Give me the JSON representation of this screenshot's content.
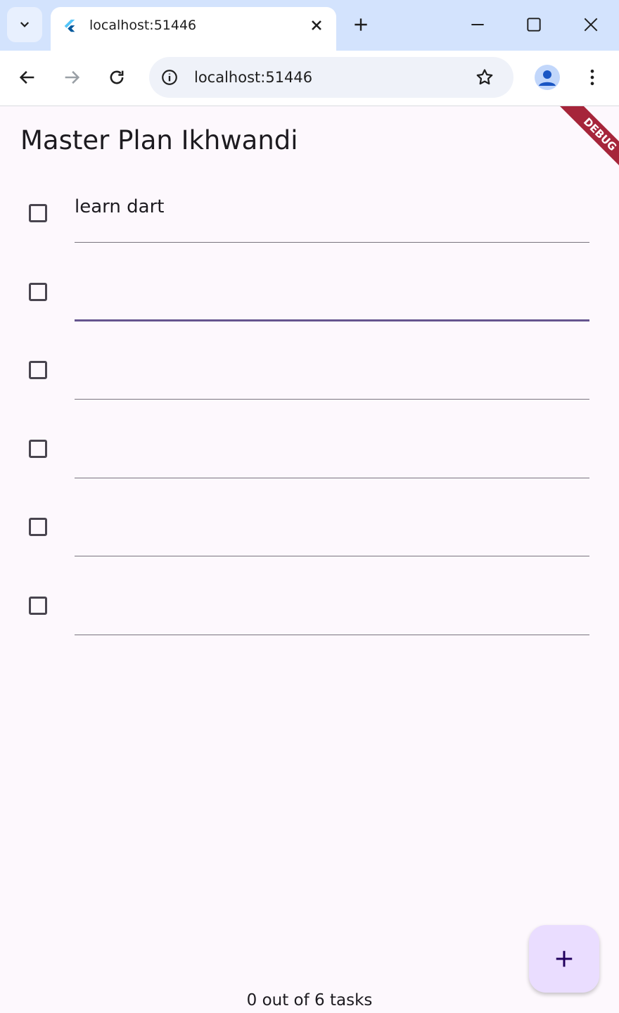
{
  "browser": {
    "tab_title": "localhost:51446",
    "url": "localhost:51446"
  },
  "app": {
    "title": "Master Plan Ikhwandi",
    "debug_banner": "DEBUG",
    "tasks": [
      {
        "description": "learn dart",
        "complete": false,
        "focused": false
      },
      {
        "description": "",
        "complete": false,
        "focused": true
      },
      {
        "description": "",
        "complete": false,
        "focused": false
      },
      {
        "description": "",
        "complete": false,
        "focused": false
      },
      {
        "description": "",
        "complete": false,
        "focused": false
      },
      {
        "description": "",
        "complete": false,
        "focused": false
      }
    ],
    "footer": "0 out of 6 tasks"
  },
  "colors": {
    "accent": "#65558f",
    "fab": "#eaddff",
    "background": "#fdf8fd",
    "debug_ribbon": "#a6253a"
  },
  "icons": [
    "chevron-down-icon",
    "flutter-icon",
    "close-icon",
    "plus-icon",
    "minimize-icon",
    "maximize-icon",
    "window-close-icon",
    "back-icon",
    "forward-icon",
    "reload-icon",
    "info-icon",
    "star-icon",
    "profile-icon",
    "more-vert-icon",
    "add-icon"
  ]
}
